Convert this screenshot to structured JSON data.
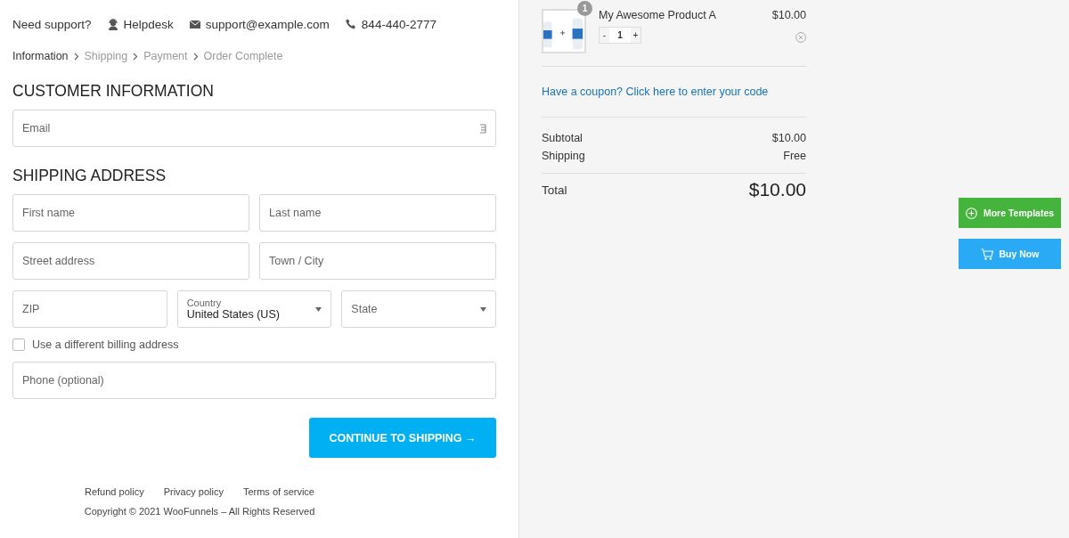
{
  "support": {
    "label": "Need support?",
    "items": [
      {
        "kind": "helpdesk",
        "text": "Helpdesk"
      },
      {
        "kind": "email",
        "text": "support@example.com"
      },
      {
        "kind": "phone",
        "text": "844-440-2777"
      }
    ]
  },
  "breadcrumb": [
    {
      "label": "Information",
      "selected": true
    },
    {
      "label": "Shipping",
      "selected": false
    },
    {
      "label": "Payment",
      "selected": false
    },
    {
      "label": "Order Complete",
      "selected": false
    }
  ],
  "customer_information": {
    "heading": "CUSTOMER INFORMATION",
    "email": {
      "placeholder": "Email"
    }
  },
  "shipping_address": {
    "heading": "SHIPPING ADDRESS",
    "rows": [
      [
        {
          "kind": "input",
          "placeholder": "First name"
        },
        {
          "kind": "input",
          "placeholder": "Last name"
        }
      ],
      [
        {
          "kind": "input",
          "placeholder": "Street address"
        },
        {
          "kind": "input",
          "placeholder": "Town / City"
        }
      ],
      [
        {
          "kind": "input",
          "placeholder": "ZIP"
        },
        {
          "kind": "select",
          "label": "Country",
          "value": "United States (US)"
        },
        {
          "kind": "select",
          "placeholder": "State"
        }
      ]
    ]
  },
  "billing_checkbox": {
    "label": "Use a different billing address",
    "checked": false
  },
  "phone": {
    "placeholder": "Phone (optional)"
  },
  "continue_button": {
    "label": "CONTINUE TO SHIPPING →"
  },
  "footer": {
    "links": [
      "Refund policy",
      "Privacy policy",
      "Terms of service"
    ],
    "copyright": "Copyright © 2021 WooFunnels – All Rights Reserved"
  },
  "cart": {
    "item": {
      "name": "My Awesome Product A",
      "price": "$10.00",
      "badge": "1",
      "minus": "-",
      "quantity": "1",
      "plus": "+"
    },
    "coupon": "Have a coupon? Click here to enter your code",
    "subtotal": {
      "label": "Subtotal",
      "value": "$10.00"
    },
    "shipping": {
      "label": "Shipping",
      "value": "Free"
    },
    "total": {
      "label": "Total",
      "value": "$10.00"
    }
  },
  "side_buttons": [
    {
      "kind": "templates",
      "label": "More Templates",
      "color": "#45b43c"
    },
    {
      "kind": "buy",
      "label": "Buy Now",
      "color": "#2aa9f4"
    }
  ]
}
